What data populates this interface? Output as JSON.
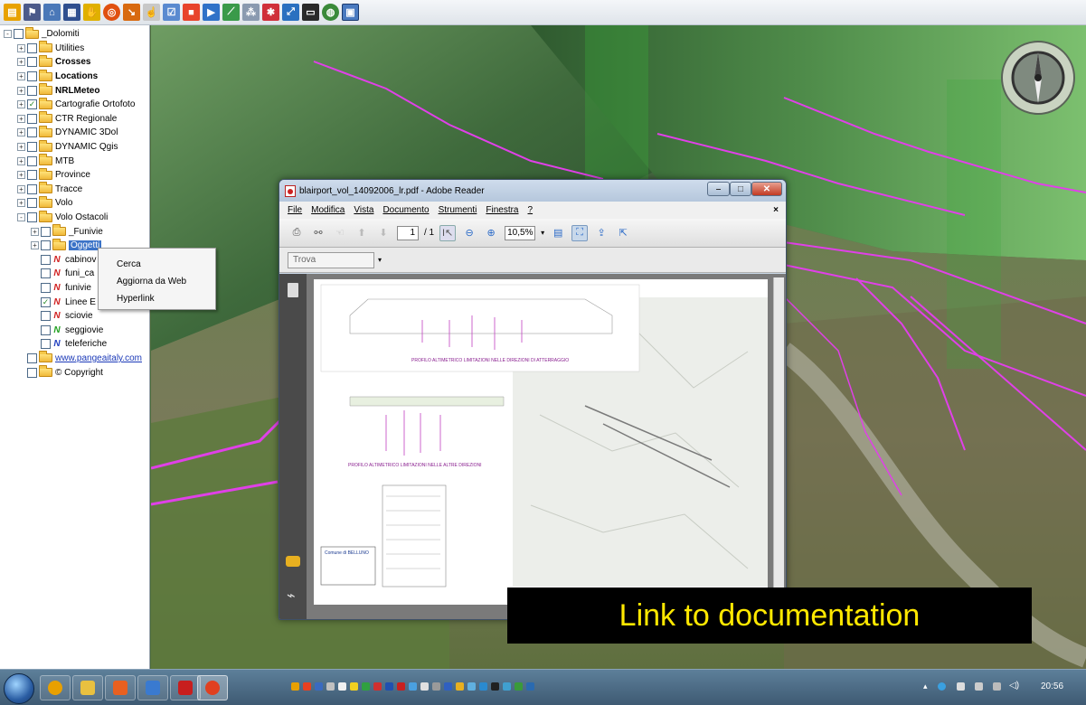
{
  "tree": {
    "nodes": [
      {
        "label": "_Dolomiti",
        "level": 0,
        "expander": "-",
        "checked": false,
        "icon": "folder",
        "style": ""
      },
      {
        "label": "Utilities",
        "level": 1,
        "expander": "+",
        "checked": false,
        "icon": "folder",
        "style": ""
      },
      {
        "label": "Crosses",
        "level": 1,
        "expander": "+",
        "checked": false,
        "icon": "folder",
        "style": "bold"
      },
      {
        "label": "Locations",
        "level": 1,
        "expander": "+",
        "checked": false,
        "icon": "folder",
        "style": "bold"
      },
      {
        "label": "NRLMeteo",
        "level": 1,
        "expander": "+",
        "checked": false,
        "icon": "folder",
        "style": "bold"
      },
      {
        "label": "Cartografie Ortofoto",
        "level": 1,
        "expander": "+",
        "checked": true,
        "icon": "folder",
        "style": ""
      },
      {
        "label": "CTR Regionale",
        "level": 1,
        "expander": "+",
        "checked": false,
        "icon": "folder",
        "style": ""
      },
      {
        "label": "DYNAMIC 3Dol",
        "level": 1,
        "expander": "+",
        "checked": false,
        "icon": "folder",
        "style": ""
      },
      {
        "label": "DYNAMIC Qgis",
        "level": 1,
        "expander": "+",
        "checked": false,
        "icon": "folder",
        "style": ""
      },
      {
        "label": "MTB",
        "level": 1,
        "expander": "+",
        "checked": false,
        "icon": "folder",
        "style": ""
      },
      {
        "label": "Province",
        "level": 1,
        "expander": "+",
        "checked": false,
        "icon": "folder",
        "style": ""
      },
      {
        "label": "Tracce",
        "level": 1,
        "expander": "+",
        "checked": false,
        "icon": "folder",
        "style": ""
      },
      {
        "label": "Volo",
        "level": 1,
        "expander": "+",
        "checked": false,
        "icon": "folder",
        "style": ""
      },
      {
        "label": "Volo Ostacoli",
        "level": 1,
        "expander": "-",
        "checked": false,
        "icon": "folder",
        "style": ""
      },
      {
        "label": "_Funivie",
        "level": 2,
        "expander": "+",
        "checked": false,
        "icon": "folder",
        "style": ""
      },
      {
        "label": "Oggetti",
        "level": 2,
        "expander": "+",
        "checked": false,
        "icon": "folder",
        "style": "selected"
      },
      {
        "label": "cabinov",
        "level": 2,
        "expander": "",
        "checked": false,
        "icon": "line-red",
        "style": ""
      },
      {
        "label": "funi_ca",
        "level": 2,
        "expander": "",
        "checked": false,
        "icon": "line-red",
        "style": ""
      },
      {
        "label": "funivie",
        "level": 2,
        "expander": "",
        "checked": false,
        "icon": "line-red",
        "style": ""
      },
      {
        "label": "Linee E",
        "level": 2,
        "expander": "",
        "checked": true,
        "icon": "line-red",
        "style": ""
      },
      {
        "label": "sciovie",
        "level": 2,
        "expander": "",
        "checked": false,
        "icon": "line-red",
        "style": ""
      },
      {
        "label": "seggiovie",
        "level": 2,
        "expander": "",
        "checked": false,
        "icon": "line-green",
        "style": ""
      },
      {
        "label": "teleferiche",
        "level": 2,
        "expander": "",
        "checked": false,
        "icon": "line-blue",
        "style": ""
      },
      {
        "label": "www.pangeaitaly.com",
        "level": 1,
        "expander": "",
        "checked": false,
        "icon": "folder",
        "style": "link"
      },
      {
        "label": "© Copyright",
        "level": 1,
        "expander": "",
        "checked": false,
        "icon": "folder",
        "style": ""
      }
    ]
  },
  "context_menu": {
    "items": [
      "Cerca",
      "Aggiorna da Web",
      "Hyperlink"
    ]
  },
  "reader": {
    "title": "blairport_vol_14092006_lr.pdf - Adobe Reader",
    "menu": [
      "File",
      "Modifica",
      "Vista",
      "Documento",
      "Strumenti",
      "Finestra",
      "?"
    ],
    "close_doc": "×",
    "page_current": "1",
    "page_total": "/ 1",
    "zoom": "10,5%",
    "find_placeholder": "Trova",
    "doc_heading_1": "PROFILO ALTIMETRICO LIMITAZIONI NELLE DIREZIONI DI ATTERRAGGIO",
    "doc_heading_2": "PROFILO ALTIMETRICO LIMITAZIONI NELLE ALTRE DIREZIONI",
    "doc_stamp": "Comune di BELLUNO"
  },
  "caption": "Link to documentation",
  "taskbar": {
    "clock": "20:56"
  },
  "colors": {
    "accent": "#3b73c7",
    "track": "#e040e8",
    "caption_text": "#ffe800"
  }
}
